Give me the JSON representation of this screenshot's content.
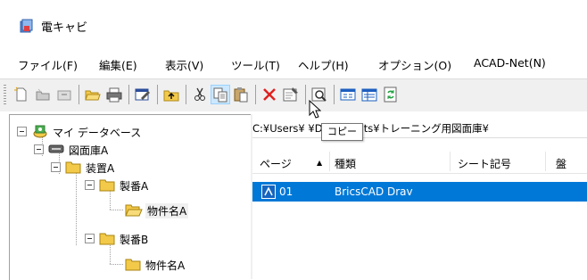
{
  "window": {
    "title": "電キャビ",
    "app_icon": "app-icon"
  },
  "menu": [
    {
      "label": "ファイル(F)"
    },
    {
      "label": "編集(E)"
    },
    {
      "label": "表示(V)"
    },
    {
      "label": "ツール(T)"
    },
    {
      "label": "ヘルプ(H)"
    },
    {
      "label": "オプション(O)"
    },
    {
      "label": "ACAD-Net(N)"
    }
  ],
  "toolbar": {
    "buttons": [
      {
        "icon": "new-document-icon"
      },
      {
        "icon": "new-folder-icon"
      },
      {
        "icon": "new-drawer-icon"
      },
      {
        "icon": "open-folder-icon"
      },
      {
        "icon": "print-icon"
      },
      {
        "icon": "edit-properties-icon"
      },
      {
        "icon": "up-folder-icon"
      },
      {
        "icon": "cut-icon"
      },
      {
        "icon": "copy-icon",
        "active": true
      },
      {
        "icon": "paste-icon"
      },
      {
        "icon": "delete-icon"
      },
      {
        "icon": "properties-icon"
      },
      {
        "icon": "search-icon"
      },
      {
        "icon": "view-list-icon"
      },
      {
        "icon": "view-details-icon"
      },
      {
        "icon": "refresh-icon"
      }
    ]
  },
  "tooltip": {
    "text": "コピー"
  },
  "tree": {
    "root": "マイ データベース",
    "nodes": [
      {
        "label": "図面庫A"
      },
      {
        "label": "装置A"
      },
      {
        "label": "製番A"
      },
      {
        "label": "物件名A"
      },
      {
        "label": "製番B"
      },
      {
        "label": "物件名A"
      }
    ]
  },
  "path": {
    "text": "C:¥Users¥        ¥Documents¥トレーニング用図面庫¥"
  },
  "list": {
    "columns": [
      {
        "label": "ページ",
        "sort": "▲"
      },
      {
        "label": "種類"
      },
      {
        "label": "シート記号"
      },
      {
        "label": "盤"
      }
    ],
    "rows": [
      {
        "page": "01",
        "type": "BricsCAD Drav",
        "selected": true
      }
    ]
  },
  "colors": {
    "selection": "#0078d7",
    "toolbar_bg": "#f0f0f0",
    "folder": "#f3c94a"
  }
}
